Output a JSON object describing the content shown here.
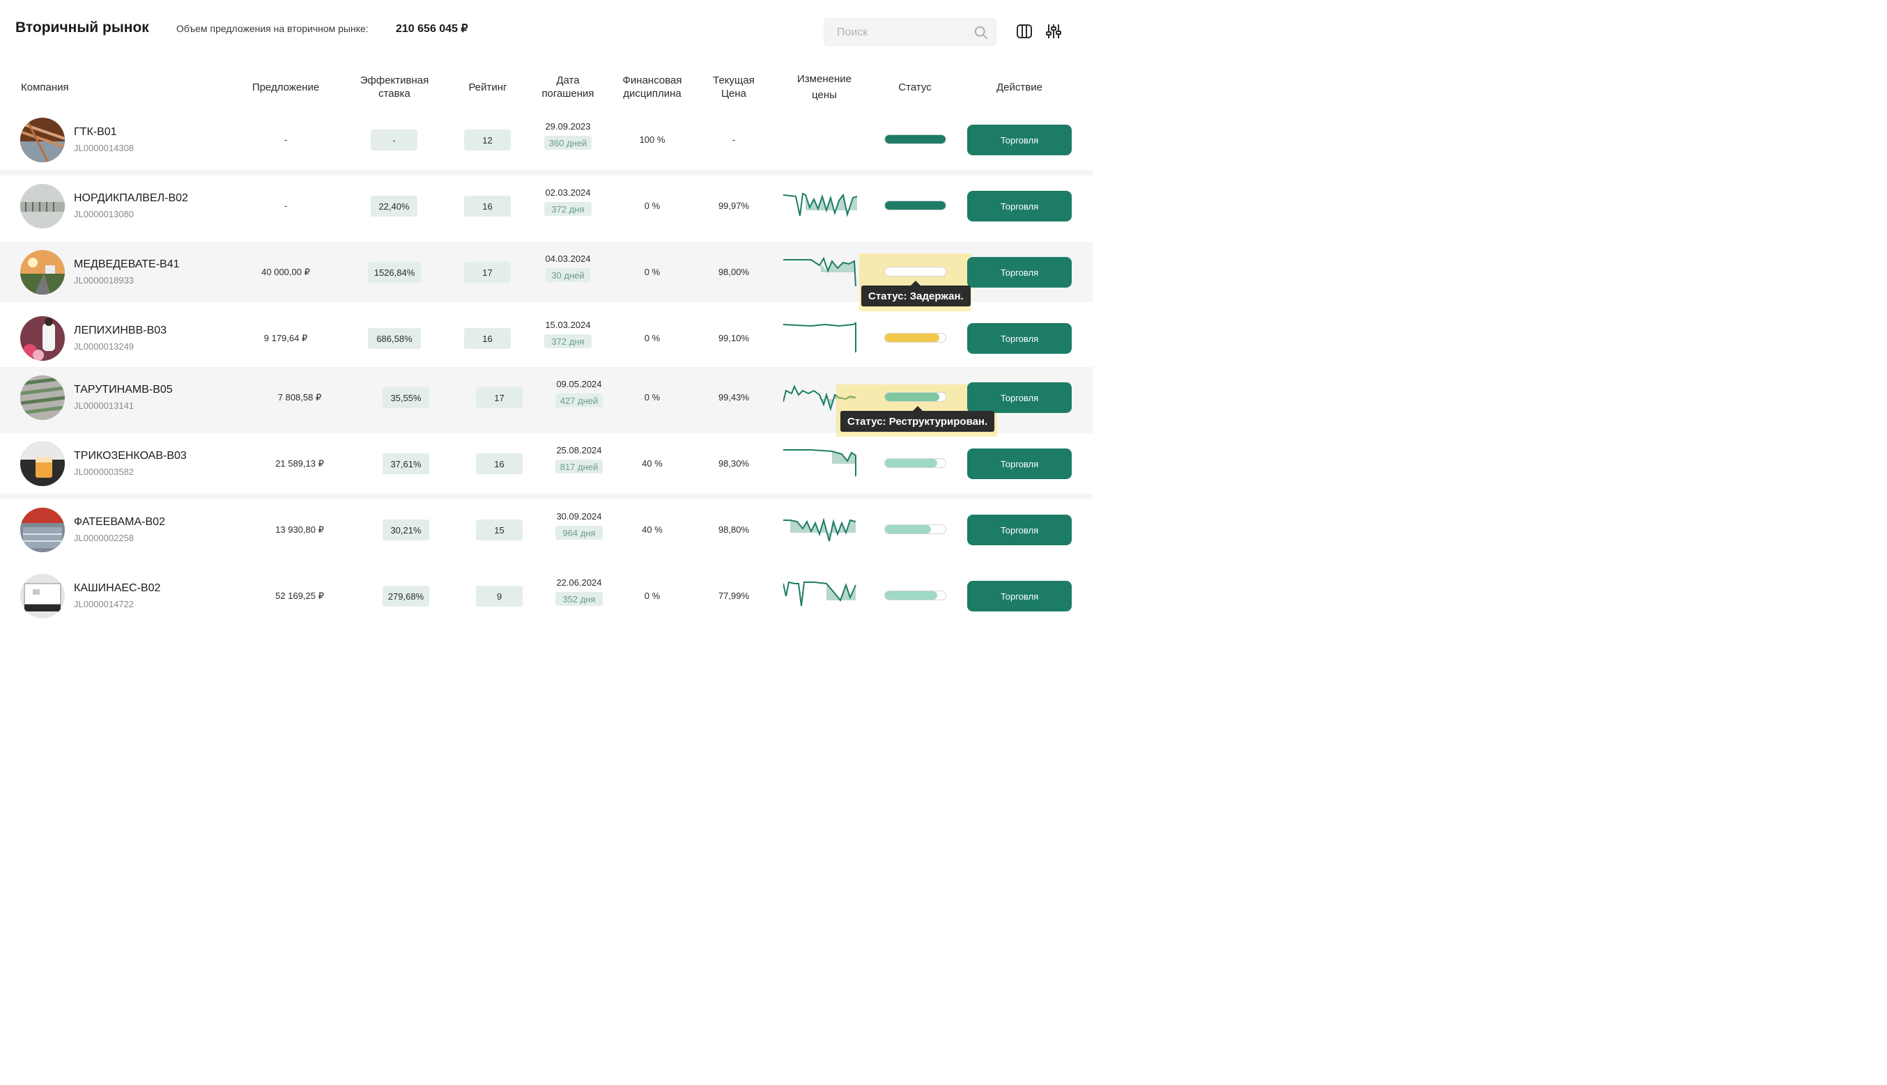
{
  "header": {
    "title": "Вторичный рынок",
    "volume_label": "Объем предложения на вторичном рынке:",
    "volume_value": "210 656 045 ₽",
    "search_placeholder": "Поиск"
  },
  "columns": {
    "company": "Компания",
    "offer": "Предложение",
    "rate_l1": "Эффективная",
    "rate_l2": "ставка",
    "rating": "Рейтинг",
    "maturity_l1": "Дата",
    "maturity_l2": "погашения",
    "discipline_l1": "Финансовая",
    "discipline_l2": "дисциплина",
    "price_l1": "Текущая",
    "price_l2": "Цена",
    "change_l1": "Изменение",
    "change_l2": "цены",
    "status": "Статус",
    "action": "Действие"
  },
  "rows": [
    {
      "name": "ГТК-В01",
      "code": "JL0000014308",
      "offer": "-",
      "rate": "-",
      "rating": "12",
      "date": "29.09.2023",
      "days": "360 дней",
      "discipline": "100 %",
      "price": "-",
      "status_fill": 1.0,
      "trade_label": "Торговля"
    },
    {
      "name": "НОРДИКПАЛВЕЛ-В02",
      "code": "JL0000013080",
      "offer": "-",
      "rate": "22,40%",
      "rating": "16",
      "date": "02.03.2024",
      "days": "372 дня",
      "discipline": "0 %",
      "price": "99,97%",
      "status_fill": 1.0,
      "trade_label": "Торговля"
    },
    {
      "name": "МЕДВЕДЕВАТЕ-В41",
      "code": "JL0000018933",
      "offer": "40 000,00 ₽",
      "rate": "1526,84%",
      "rating": "17",
      "date": "04.03.2024",
      "days": "30 дней",
      "discipline": "0 %",
      "price": "98,00%",
      "status_fill": 0.0,
      "trade_label": "Торговля"
    },
    {
      "name": "ЛЕПИХИНВВ-В03",
      "code": "JL0000013249",
      "offer": "9 179,64 ₽",
      "rate": "686,58%",
      "rating": "16",
      "date": "15.03.2024",
      "days": "372 дня",
      "discipline": "0 %",
      "price": "99,10%",
      "status_fill": 0.9,
      "trade_label": "Торговля"
    },
    {
      "name": "ТАРУТИНАМВ-В05",
      "code": "JL0000013141",
      "offer": "7 808,58 ₽",
      "rate": "35,55%",
      "rating": "17",
      "date": "09.05.2024",
      "days": "427 дней",
      "discipline": "0 %",
      "price": "99,43%",
      "status_fill": 0.9,
      "trade_label": "Торговля"
    },
    {
      "name": "ТРИКОЗЕНКОАВ-В03",
      "code": "JL0000003582",
      "offer": "21 589,13 ₽",
      "rate": "37,61%",
      "rating": "16",
      "date": "25.08.2024",
      "days": "817 дней",
      "discipline": "40 %",
      "price": "98,30%",
      "status_fill": 0.86,
      "trade_label": "Торговля"
    },
    {
      "name": "ФАТЕЕВАМА-В02",
      "code": "JL0000002258",
      "offer": "13 930,80 ₽",
      "rate": "30,21%",
      "rating": "15",
      "date": "30.09.2024",
      "days": "964 дня",
      "discipline": "40 %",
      "price": "98,80%",
      "status_fill": 0.76,
      "trade_label": "Торговля"
    },
    {
      "name": "КАШИНАЕС-В02",
      "code": "JL0000014722",
      "offer": "52 169,25 ₽",
      "rate": "279,68%",
      "rating": "9",
      "date": "22.06.2024",
      "days": "352 дня",
      "discipline": "0 %",
      "price": "77,99%",
      "status_fill": 0.86,
      "trade_label": "Торговля"
    }
  ],
  "tooltips": {
    "delayed": "Статус: Задержан.",
    "restructured": "Статус: Реструктурирован."
  },
  "colors": {
    "accent": "#1d7c66",
    "pill_bg": "#e3eeec",
    "status_dark": "#1d7c66",
    "status_yellow": "#f2c94c",
    "status_mid": "#7ec79e",
    "status_light": "#9fd9c6",
    "tooltip_highlight": "#fade5a"
  },
  "icons": {
    "search": "search-icon",
    "columns": "columns-icon",
    "filter": "sliders-icon"
  }
}
